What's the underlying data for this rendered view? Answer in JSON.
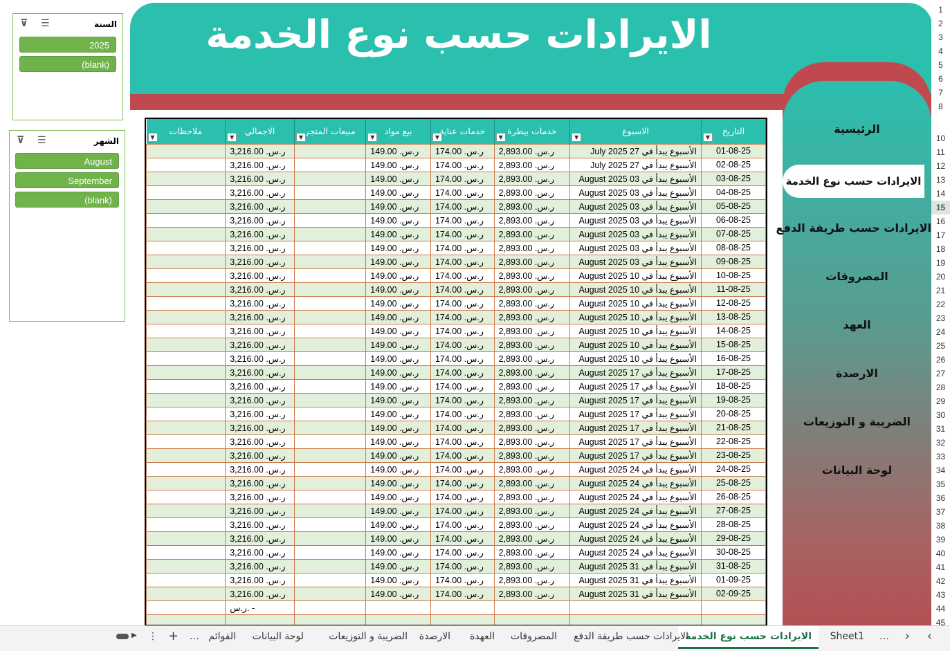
{
  "title": "الايرادات حسب  نوع الخدمة",
  "nav": {
    "items": [
      {
        "label": "الرئيسية"
      },
      {
        "label": "الايرادات حسب نوع الخدمة",
        "active": true
      },
      {
        "label": "الايرادات حسب طريقة الدفع"
      },
      {
        "label": "المصروفات"
      },
      {
        "label": "العهد"
      },
      {
        "label": "الارصدة"
      },
      {
        "label": "الضريبة و التوزيعات"
      },
      {
        "label": "لوحة البيانات"
      }
    ]
  },
  "slicers": {
    "year": {
      "label": "السنة",
      "items": [
        "2025",
        "(blank)"
      ]
    },
    "month": {
      "label": "الشهر",
      "items": [
        "August",
        "September",
        "(blank)"
      ]
    }
  },
  "table": {
    "columns": [
      "التاريخ",
      "الاسبوع",
      "خدمات بيطرة",
      "خدمات عناية",
      "بيع مواد",
      "مبيعات المتجر",
      "الاجمالي",
      "ملاحظات"
    ],
    "rows": [
      [
        "01-08-25",
        "الأسبوع يبدأ في 27 July 2025",
        "ر.س. 2,893.00",
        "ر.س. 174.00",
        "ر.س. 149.00",
        "",
        "ر.س. 3,216.00",
        ""
      ],
      [
        "02-08-25",
        "الأسبوع يبدأ في 27 July 2025",
        "ر.س. 2,893.00",
        "ر.س. 174.00",
        "ر.س. 149.00",
        "",
        "ر.س. 3,216.00",
        ""
      ],
      [
        "03-08-25",
        "الأسبوع يبدأ في 03 August 2025",
        "ر.س. 2,893.00",
        "ر.س. 174.00",
        "ر.س. 149.00",
        "",
        "ر.س. 3,216.00",
        ""
      ],
      [
        "04-08-25",
        "الأسبوع يبدأ في 03 August 2025",
        "ر.س. 2,893.00",
        "ر.س. 174.00",
        "ر.س. 149.00",
        "",
        "ر.س. 3,216.00",
        ""
      ],
      [
        "05-08-25",
        "الأسبوع يبدأ في 03 August 2025",
        "ر.س. 2,893.00",
        "ر.س. 174.00",
        "ر.س. 149.00",
        "",
        "ر.س. 3,216.00",
        ""
      ],
      [
        "06-08-25",
        "الأسبوع يبدأ في 03 August 2025",
        "ر.س. 2,893.00",
        "ر.س. 174.00",
        "ر.س. 149.00",
        "",
        "ر.س. 3,216.00",
        ""
      ],
      [
        "07-08-25",
        "الأسبوع يبدأ في 03 August 2025",
        "ر.س. 2,893.00",
        "ر.س. 174.00",
        "ر.س. 149.00",
        "",
        "ر.س. 3,216.00",
        ""
      ],
      [
        "08-08-25",
        "الأسبوع يبدأ في 03 August 2025",
        "ر.س. 2,893.00",
        "ر.س. 174.00",
        "ر.س. 149.00",
        "",
        "ر.س. 3,216.00",
        ""
      ],
      [
        "09-08-25",
        "الأسبوع يبدأ في 03 August 2025",
        "ر.س. 2,893.00",
        "ر.س. 174.00",
        "ر.س. 149.00",
        "",
        "ر.س. 3,216.00",
        ""
      ],
      [
        "10-08-25",
        "الأسبوع يبدأ في 10 August 2025",
        "ر.س. 2,893.00",
        "ر.س. 174.00",
        "ر.س. 149.00",
        "",
        "ر.س. 3,216.00",
        ""
      ],
      [
        "11-08-25",
        "الأسبوع يبدأ في 10 August 2025",
        "ر.س. 2,893.00",
        "ر.س. 174.00",
        "ر.س. 149.00",
        "",
        "ر.س. 3,216.00",
        ""
      ],
      [
        "12-08-25",
        "الأسبوع يبدأ في 10 August 2025",
        "ر.س. 2,893.00",
        "ر.س. 174.00",
        "ر.س. 149.00",
        "",
        "ر.س. 3,216.00",
        ""
      ],
      [
        "13-08-25",
        "الأسبوع يبدأ في 10 August 2025",
        "ر.س. 2,893.00",
        "ر.س. 174.00",
        "ر.س. 149.00",
        "",
        "ر.س. 3,216.00",
        ""
      ],
      [
        "14-08-25",
        "الأسبوع يبدأ في 10 August 2025",
        "ر.س. 2,893.00",
        "ر.س. 174.00",
        "ر.س. 149.00",
        "",
        "ر.س. 3,216.00",
        ""
      ],
      [
        "15-08-25",
        "الأسبوع يبدأ في 10 August 2025",
        "ر.س. 2,893.00",
        "ر.س. 174.00",
        "ر.س. 149.00",
        "",
        "ر.س. 3,216.00",
        ""
      ],
      [
        "16-08-25",
        "الأسبوع يبدأ في 10 August 2025",
        "ر.س. 2,893.00",
        "ر.س. 174.00",
        "ر.س. 149.00",
        "",
        "ر.س. 3,216.00",
        ""
      ],
      [
        "17-08-25",
        "الأسبوع يبدأ في 17 August 2025",
        "ر.س. 2,893.00",
        "ر.س. 174.00",
        "ر.س. 149.00",
        "",
        "ر.س. 3,216.00",
        ""
      ],
      [
        "18-08-25",
        "الأسبوع يبدأ في 17 August 2025",
        "ر.س. 2,893.00",
        "ر.س. 174.00",
        "ر.س. 149.00",
        "",
        "ر.س. 3,216.00",
        ""
      ],
      [
        "19-08-25",
        "الأسبوع يبدأ في 17 August 2025",
        "ر.س. 2,893.00",
        "ر.س. 174.00",
        "ر.س. 149.00",
        "",
        "ر.س. 3,216.00",
        ""
      ],
      [
        "20-08-25",
        "الأسبوع يبدأ في 17 August 2025",
        "ر.س. 2,893.00",
        "ر.س. 174.00",
        "ر.س. 149.00",
        "",
        "ر.س. 3,216.00",
        ""
      ],
      [
        "21-08-25",
        "الأسبوع يبدأ في 17 August 2025",
        "ر.س. 2,893.00",
        "ر.س. 174.00",
        "ر.س. 149.00",
        "",
        "ر.س. 3,216.00",
        ""
      ],
      [
        "22-08-25",
        "الأسبوع يبدأ في 17 August 2025",
        "ر.س. 2,893.00",
        "ر.س. 174.00",
        "ر.س. 149.00",
        "",
        "ر.س. 3,216.00",
        ""
      ],
      [
        "23-08-25",
        "الأسبوع يبدأ في 17 August 2025",
        "ر.س. 2,893.00",
        "ر.س. 174.00",
        "ر.س. 149.00",
        "",
        "ر.س. 3,216.00",
        ""
      ],
      [
        "24-08-25",
        "الأسبوع يبدأ في 24 August 2025",
        "ر.س. 2,893.00",
        "ر.س. 174.00",
        "ر.س. 149.00",
        "",
        "ر.س. 3,216.00",
        ""
      ],
      [
        "25-08-25",
        "الأسبوع يبدأ في 24 August 2025",
        "ر.س. 2,893.00",
        "ر.س. 174.00",
        "ر.س. 149.00",
        "",
        "ر.س. 3,216.00",
        ""
      ],
      [
        "26-08-25",
        "الأسبوع يبدأ في 24 August 2025",
        "ر.س. 2,893.00",
        "ر.س. 174.00",
        "ر.س. 149.00",
        "",
        "ر.س. 3,216.00",
        ""
      ],
      [
        "27-08-25",
        "الأسبوع يبدأ في 24 August 2025",
        "ر.س. 2,893.00",
        "ر.س. 174.00",
        "ر.س. 149.00",
        "",
        "ر.س. 3,216.00",
        ""
      ],
      [
        "28-08-25",
        "الأسبوع يبدأ في 24 August 2025",
        "ر.س. 2,893.00",
        "ر.س. 174.00",
        "ر.س. 149.00",
        "",
        "ر.س. 3,216.00",
        ""
      ],
      [
        "29-08-25",
        "الأسبوع يبدأ في 24 August 2025",
        "ر.س. 2,893.00",
        "ر.س. 174.00",
        "ر.س. 149.00",
        "",
        "ر.س. 3,216.00",
        ""
      ],
      [
        "30-08-25",
        "الأسبوع يبدأ في 24 August 2025",
        "ر.س. 2,893.00",
        "ر.س. 174.00",
        "ر.س. 149.00",
        "",
        "ر.س. 3,216.00",
        ""
      ],
      [
        "31-08-25",
        "الأسبوع يبدأ في 31 August 2025",
        "ر.س. 2,893.00",
        "ر.س. 174.00",
        "ر.س. 149.00",
        "",
        "ر.س. 3,216.00",
        ""
      ],
      [
        "01-09-25",
        "الأسبوع يبدأ في 31 August 2025",
        "ر.س. 2,893.00",
        "ر.س. 174.00",
        "ر.س. 149.00",
        "",
        "ر.س. 3,216.00",
        ""
      ],
      [
        "02-09-25",
        "الأسبوع يبدأ في 31 August 2025",
        "ر.س. 2,893.00",
        "ر.س. 174.00",
        "ر.س. 149.00",
        "",
        "ر.س. 3,216.00",
        ""
      ],
      [
        "",
        "",
        "",
        "",
        "",
        "",
        "ر.س.   -",
        ""
      ],
      [
        "",
        "",
        "",
        "",
        "",
        "",
        "",
        ""
      ]
    ]
  },
  "row_numbers": [
    "1",
    "2",
    "3",
    "4",
    "5",
    "6",
    "7",
    "8",
    "10",
    "11",
    "12",
    "13",
    "14",
    "15",
    "16",
    "17",
    "18",
    "19",
    "20",
    "21",
    "22",
    "23",
    "24",
    "25",
    "26",
    "27",
    "28",
    "29",
    "30",
    "31",
    "32",
    "33",
    "34",
    "35",
    "36",
    "37",
    "38",
    "39",
    "40",
    "41",
    "42",
    "43",
    "44",
    "45"
  ],
  "active_row": "15",
  "sheet_tabs": [
    {
      "label": "Sheet1"
    },
    {
      "label": "الايرادات حسب  نوع الخدمة",
      "active": true
    },
    {
      "label": "الايرادات حسب طريقة الدفع"
    },
    {
      "label": "المصروفات"
    },
    {
      "label": "العهدة"
    },
    {
      "label": "الارصدة"
    },
    {
      "label": "الضريبة و التوزيعات"
    },
    {
      "label": "لوحة البيانات"
    },
    {
      "label": "القوائم"
    }
  ],
  "tab_controls": {
    "more": "…",
    "add": "+",
    "menu": "⋮",
    "prev": "‹",
    "next": "›"
  },
  "colors": {
    "teal": "#2bbfae",
    "red": "#c0494f",
    "green_band": "#e2efda",
    "slicer_green": "#6fb34a"
  }
}
